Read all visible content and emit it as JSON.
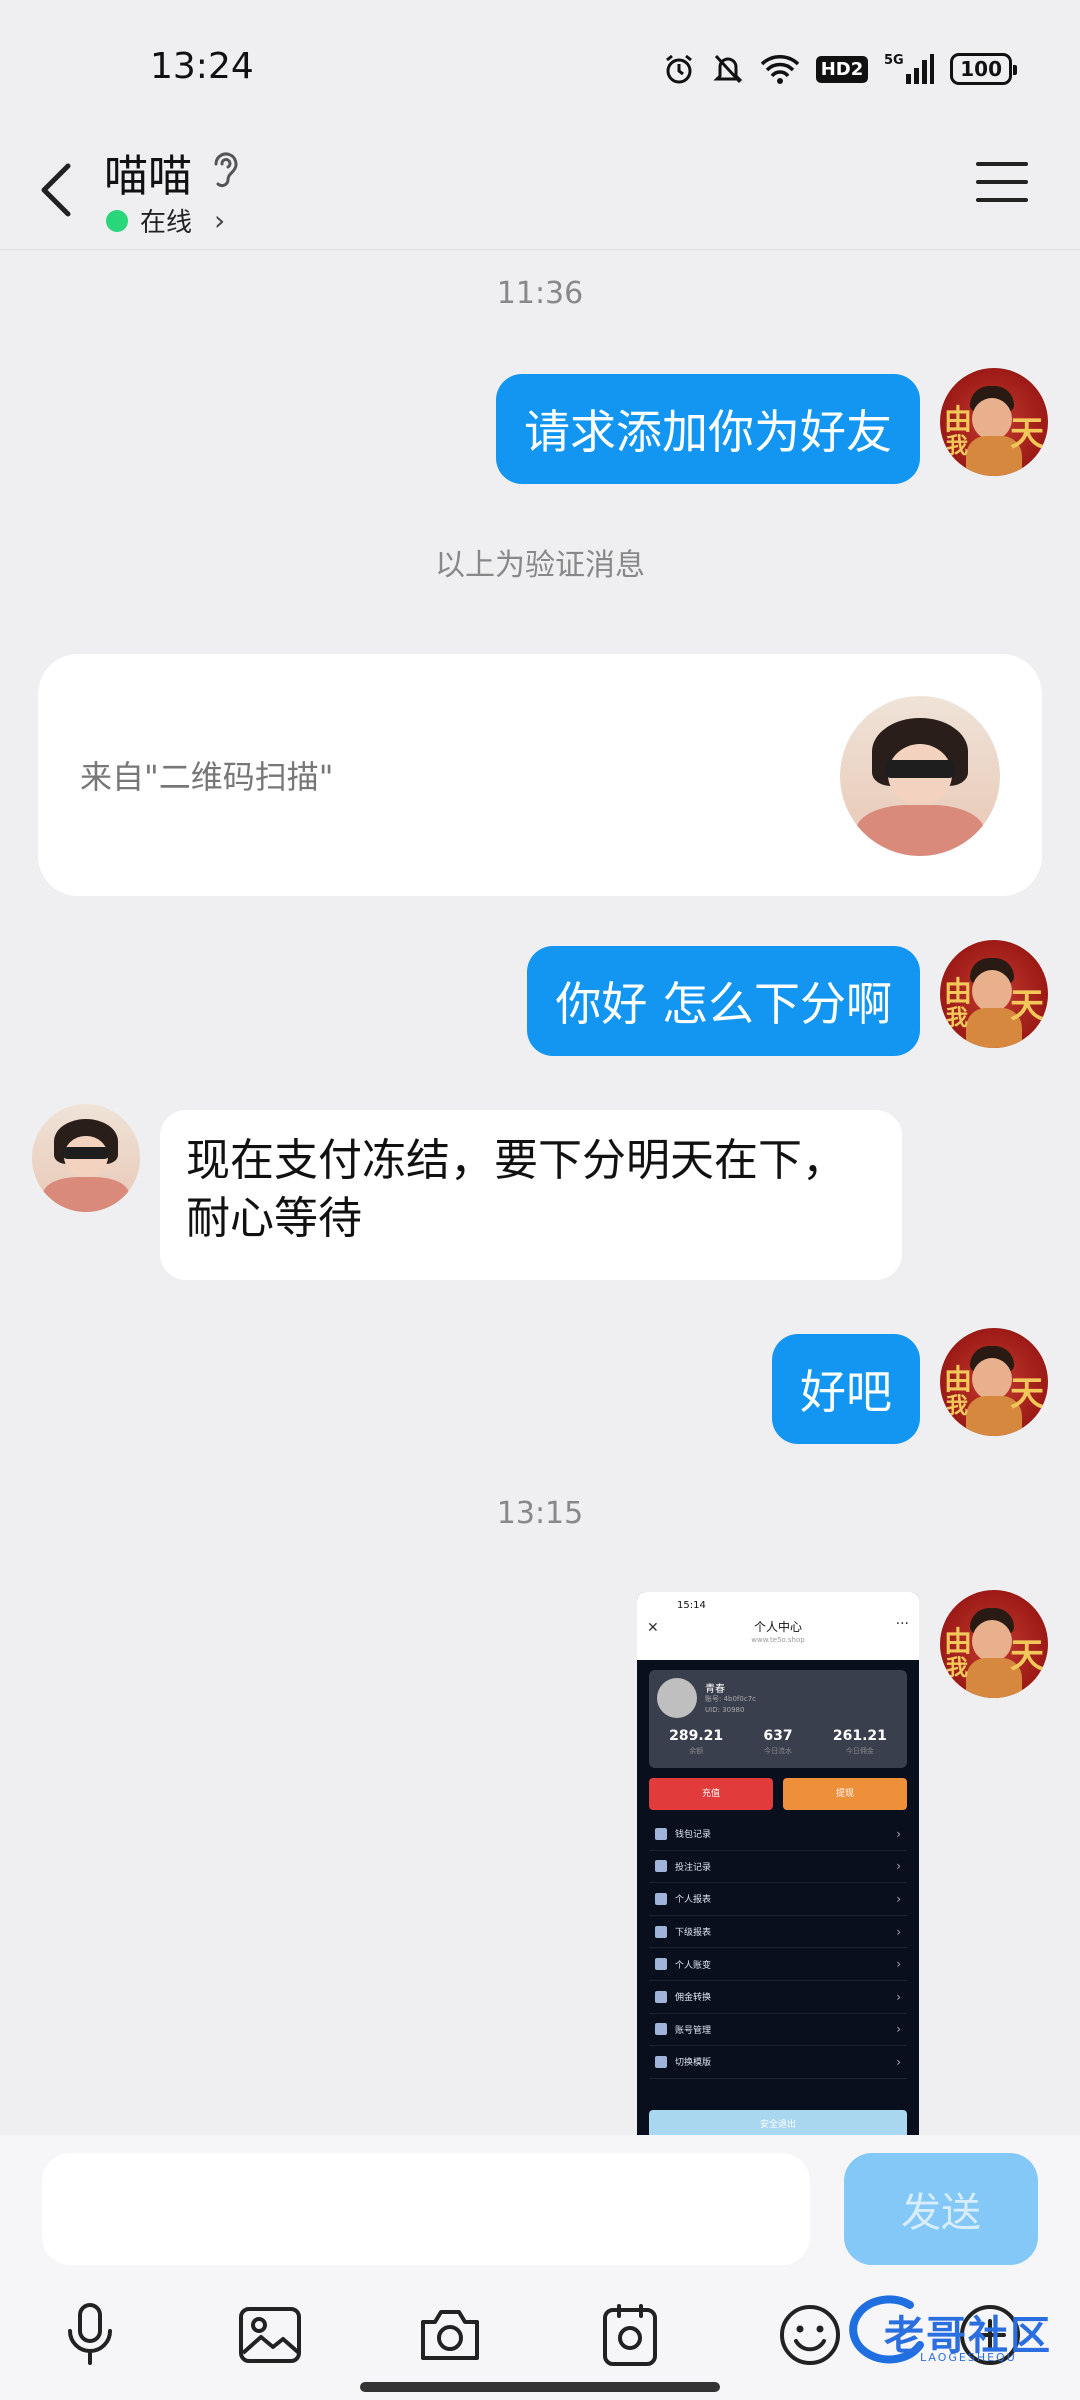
{
  "status_bar": {
    "time": "13:24",
    "network": "5G",
    "hd": "HD2",
    "battery": "100"
  },
  "header": {
    "contact_name": "喵喵",
    "online_status": "在线"
  },
  "chat": {
    "timestamps": [
      "11:36",
      "13:15"
    ],
    "messages": [
      {
        "from": "me",
        "text": "请求添加你为好友"
      },
      {
        "from": "me",
        "text": "你好  怎么下分啊"
      },
      {
        "from": "them",
        "line1": "现在支付冻结，要下分明天在下，",
        "line2": "耐心等待"
      },
      {
        "from": "me",
        "text": "好吧"
      }
    ],
    "system_notice": "以上为验证消息",
    "verify_card": {
      "text": "来自\"二维码扫描\""
    },
    "avatar_me_glyphs": [
      "由",
      "我",
      "天"
    ]
  },
  "screenshot": {
    "time": "15:14",
    "title": "个人中心",
    "url": "www.te5o.shop",
    "username": "青春",
    "account": "账号: 4b0f0c7c",
    "uid": "UID: 30980",
    "stats": [
      {
        "value": "289.21",
        "label": "余额"
      },
      {
        "value": "637",
        "label": "今日流水"
      },
      {
        "value": "261.21",
        "label": "今日佣金"
      }
    ],
    "buttons": {
      "recharge": "充值",
      "withdraw": "提现"
    },
    "menu": [
      "钱包记录",
      "投注记录",
      "个人报表",
      "下级报表",
      "个人账变",
      "佣金转换",
      "账号管理",
      "切换模版"
    ],
    "logout": "安全退出"
  },
  "input": {
    "placeholder": "",
    "send_label": "发送"
  },
  "toolbar": [
    "microphone-icon",
    "image-icon",
    "camera-icon",
    "sticker-icon",
    "emoji-icon",
    "plus-icon"
  ],
  "watermark": {
    "text": "老哥社区",
    "sub": "LAOGESHEQU"
  },
  "colors": {
    "bubble_out": "#1296f2",
    "online": "#2ad67a",
    "send_disabled": "#83c8f6"
  }
}
